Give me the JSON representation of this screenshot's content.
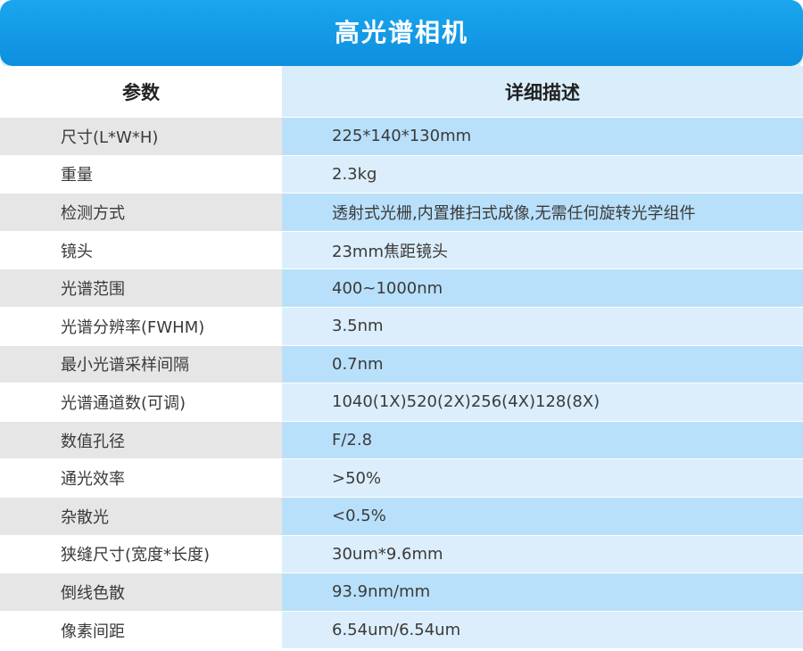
{
  "title": "高光谱相机",
  "header": {
    "param": "参数",
    "detail": "详细描述"
  },
  "rows": [
    {
      "param": "尺寸(L*W*H)",
      "detail": "225*140*130mm"
    },
    {
      "param": "重量",
      "detail": "2.3kg"
    },
    {
      "param": "检测方式",
      "detail": "透射式光栅,内置推扫式成像,无需任何旋转光学组件"
    },
    {
      "param": "镜头",
      "detail": "23mm焦距镜头"
    },
    {
      "param": "光谱范围",
      "detail": "400~1000nm"
    },
    {
      "param": "光谱分辨率(FWHM)",
      "detail": "3.5nm"
    },
    {
      "param": "最小光谱采样间隔",
      "detail": "0.7nm"
    },
    {
      "param": "光谱通道数(可调)",
      "detail": "1040(1X)520(2X)256(4X)128(8X)"
    },
    {
      "param": "数值孔径",
      "detail": "F/2.8"
    },
    {
      "param": "通光效率",
      "detail": ">50%"
    },
    {
      "param": "杂散光",
      "detail": "<0.5%"
    },
    {
      "param": "狭缝尺寸(宽度*长度)",
      "detail": "30um*9.6mm"
    },
    {
      "param": "倒线色散",
      "detail": "93.9nm/mm"
    },
    {
      "param": "像素间距",
      "detail": "6.54um/6.54um"
    }
  ]
}
